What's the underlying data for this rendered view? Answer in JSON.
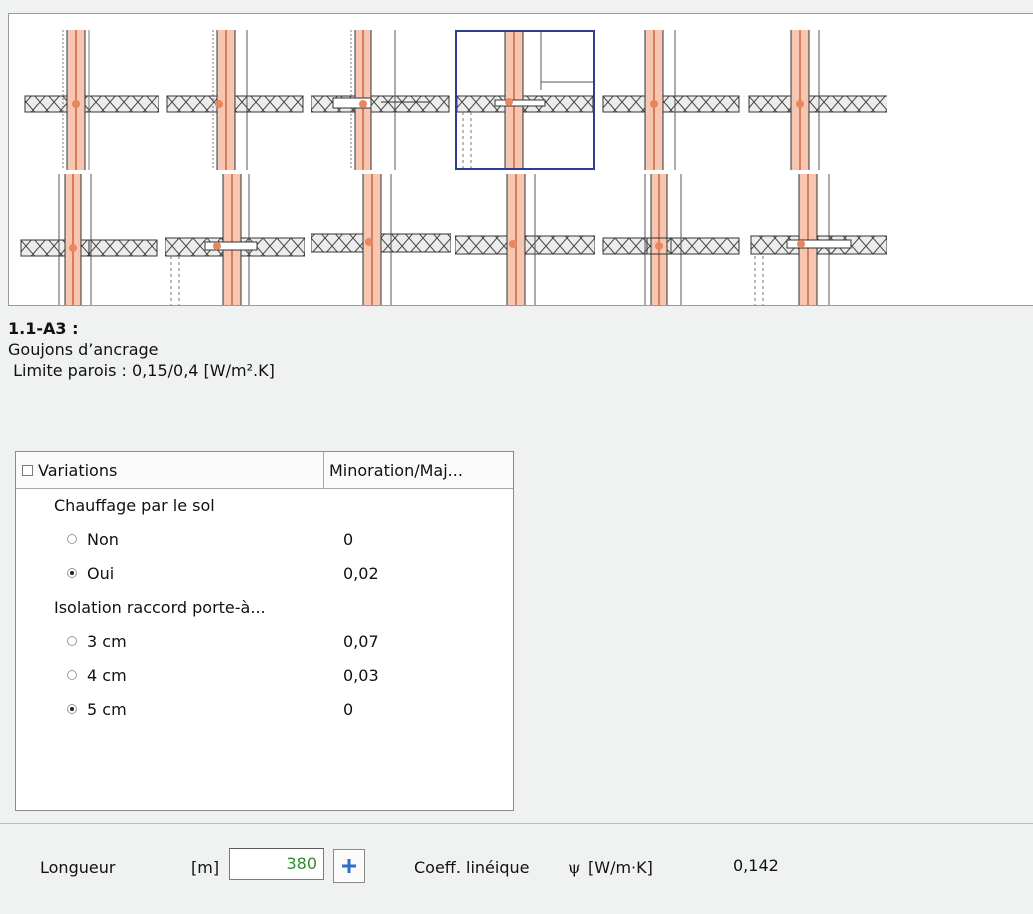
{
  "gallery": {
    "rows": 2,
    "columns": 6,
    "selected_thumbnail": "row 1, column 4"
  },
  "detail": {
    "code": "1.1-A3 :",
    "description": "Goujons d’ancrage",
    "limit": " Limite parois : 0,15/0,4 [W/m².K]"
  },
  "variations": {
    "header_checkbox_checked": false,
    "col1_header": "Variations",
    "col2_header": "Minoration/Maj...",
    "groups": [
      {
        "label": "Chauffage par le sol",
        "options": [
          {
            "label": "Non",
            "value": "0",
            "selected": false
          },
          {
            "label": "Oui",
            "value": "0,02",
            "selected": true
          }
        ]
      },
      {
        "label": "Isolation raccord porte-à...",
        "options": [
          {
            "label": "3 cm",
            "value": "0,07",
            "selected": false
          },
          {
            "label": "4 cm",
            "value": "0,03",
            "selected": false
          },
          {
            "label": "5 cm",
            "value": "0",
            "selected": true
          }
        ]
      }
    ]
  },
  "bottom": {
    "length_label": "Longueur",
    "length_unit": "[m]",
    "length_value": "380",
    "add_icon": "plus-icon",
    "coeff_label": "Coeff. linéique",
    "psi_symbol": "ψ",
    "coeff_unit": "[W/m·K]",
    "coeff_value": "0,142"
  },
  "colors": {
    "selection_border": "#2a3f8f",
    "input_value": "#2e8b2e",
    "add_icon": "#2f6fc4",
    "wall_fill": "#f7c6b1",
    "wall_stroke": "#d97e5c"
  }
}
